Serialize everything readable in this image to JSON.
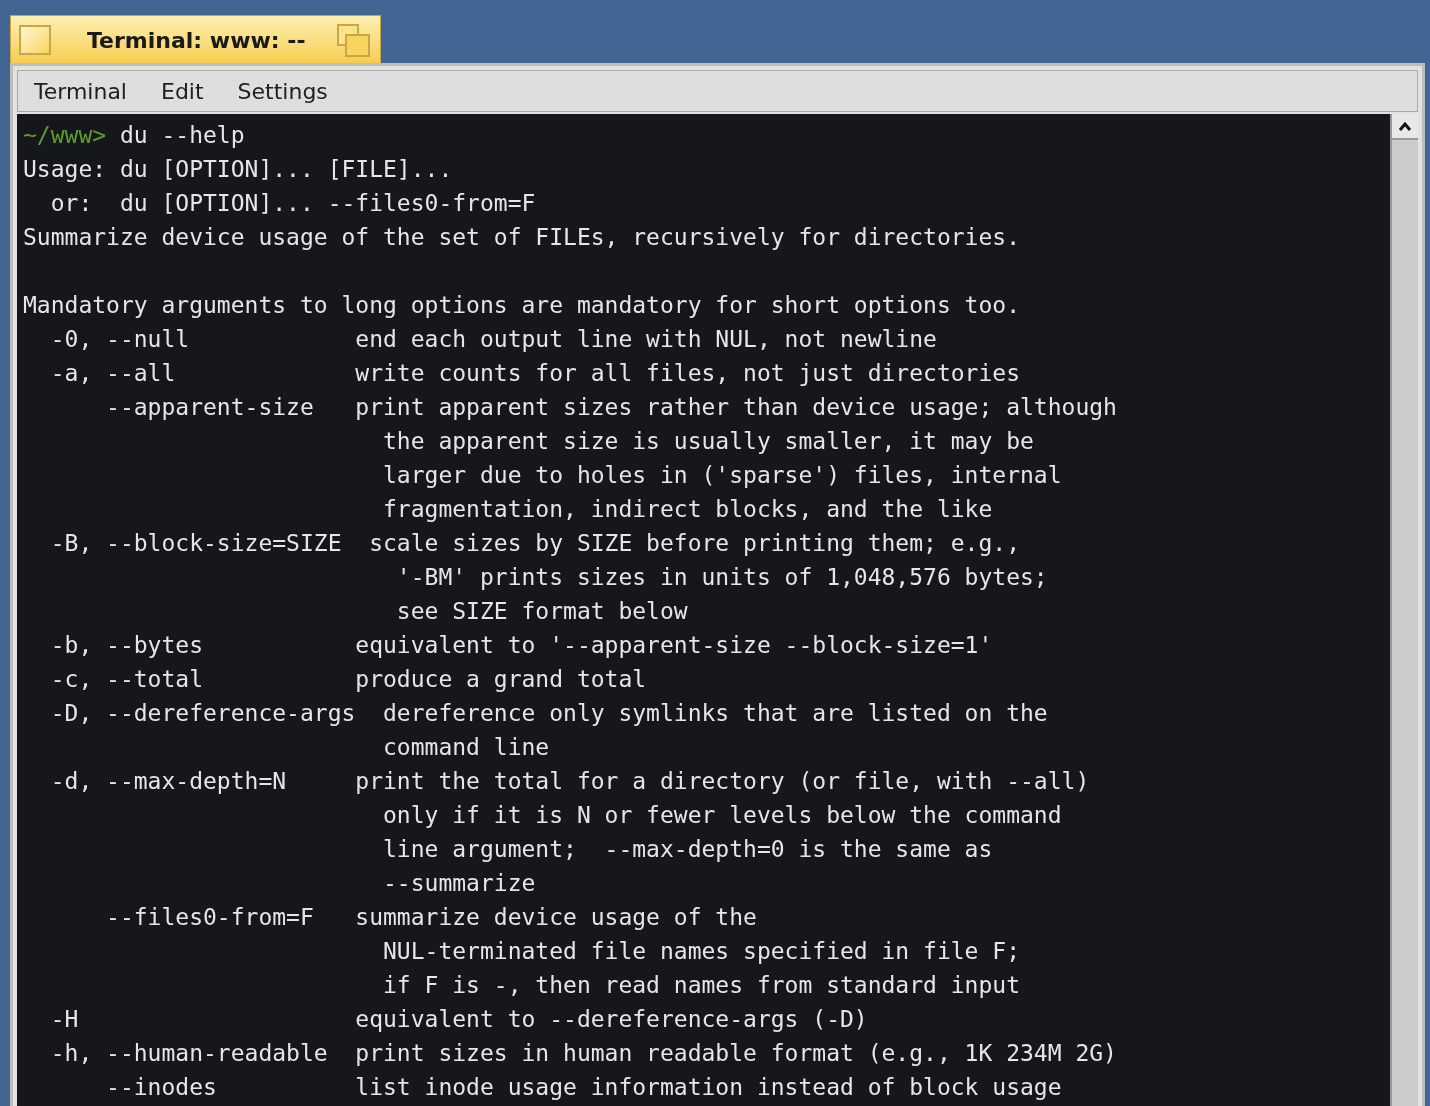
{
  "window": {
    "title": "Terminal: www: --"
  },
  "menu": [
    "Terminal",
    "Edit",
    "Settings"
  ],
  "terminal": {
    "prompt": "~/www>",
    "command": " du --help",
    "lines": [
      {
        "kind": "text",
        "text": "Usage: du [OPTION]... [FILE]..."
      },
      {
        "kind": "text",
        "text": "  or:  du [OPTION]... --files0-from=F"
      },
      {
        "kind": "text",
        "text": "Summarize device usage of the set of FILEs, recursively for directories."
      },
      {
        "kind": "blank"
      },
      {
        "kind": "text",
        "text": "Mandatory arguments to long options are mandatory for short options too."
      },
      {
        "kind": "text",
        "text": "  -0, --null            end each output line with NUL, not newline"
      },
      {
        "kind": "text",
        "text": "  -a, --all             write counts for all files, not just directories"
      },
      {
        "kind": "text",
        "text": "      --apparent-size   print apparent sizes rather than device usage; although"
      },
      {
        "kind": "text",
        "text": "                          the apparent size is usually smaller, it may be"
      },
      {
        "kind": "text",
        "text": "                          larger due to holes in ('sparse') files, internal"
      },
      {
        "kind": "text",
        "text": "                          fragmentation, indirect blocks, and the like"
      },
      {
        "kind": "text",
        "text": "  -B, --block-size=SIZE  scale sizes by SIZE before printing them; e.g.,"
      },
      {
        "kind": "text",
        "text": "                           '-BM' prints sizes in units of 1,048,576 bytes;"
      },
      {
        "kind": "text",
        "text": "                           see SIZE format below"
      },
      {
        "kind": "text",
        "text": "  -b, --bytes           equivalent to '--apparent-size --block-size=1'"
      },
      {
        "kind": "text",
        "text": "  -c, --total           produce a grand total"
      },
      {
        "kind": "text",
        "text": "  -D, --dereference-args  dereference only symlinks that are listed on the"
      },
      {
        "kind": "text",
        "text": "                          command line"
      },
      {
        "kind": "text",
        "text": "  -d, --max-depth=N     print the total for a directory (or file, with --all)"
      },
      {
        "kind": "text",
        "text": "                          only if it is N or fewer levels below the command"
      },
      {
        "kind": "text",
        "text": "                          line argument;  --max-depth=0 is the same as"
      },
      {
        "kind": "text",
        "text": "                          --summarize"
      },
      {
        "kind": "text",
        "text": "      --files0-from=F   summarize device usage of the"
      },
      {
        "kind": "text",
        "text": "                          NUL-terminated file names specified in file F;"
      },
      {
        "kind": "text",
        "text": "                          if F is -, then read names from standard input"
      },
      {
        "kind": "text",
        "text": "  -H                    equivalent to --dereference-args (-D)"
      },
      {
        "kind": "text",
        "text": "  -h, --human-readable  print sizes in human readable format (e.g., 1K 234M 2G)"
      },
      {
        "kind": "text",
        "text": "      --inodes          list inode usage information instead of block usage"
      }
    ]
  }
}
